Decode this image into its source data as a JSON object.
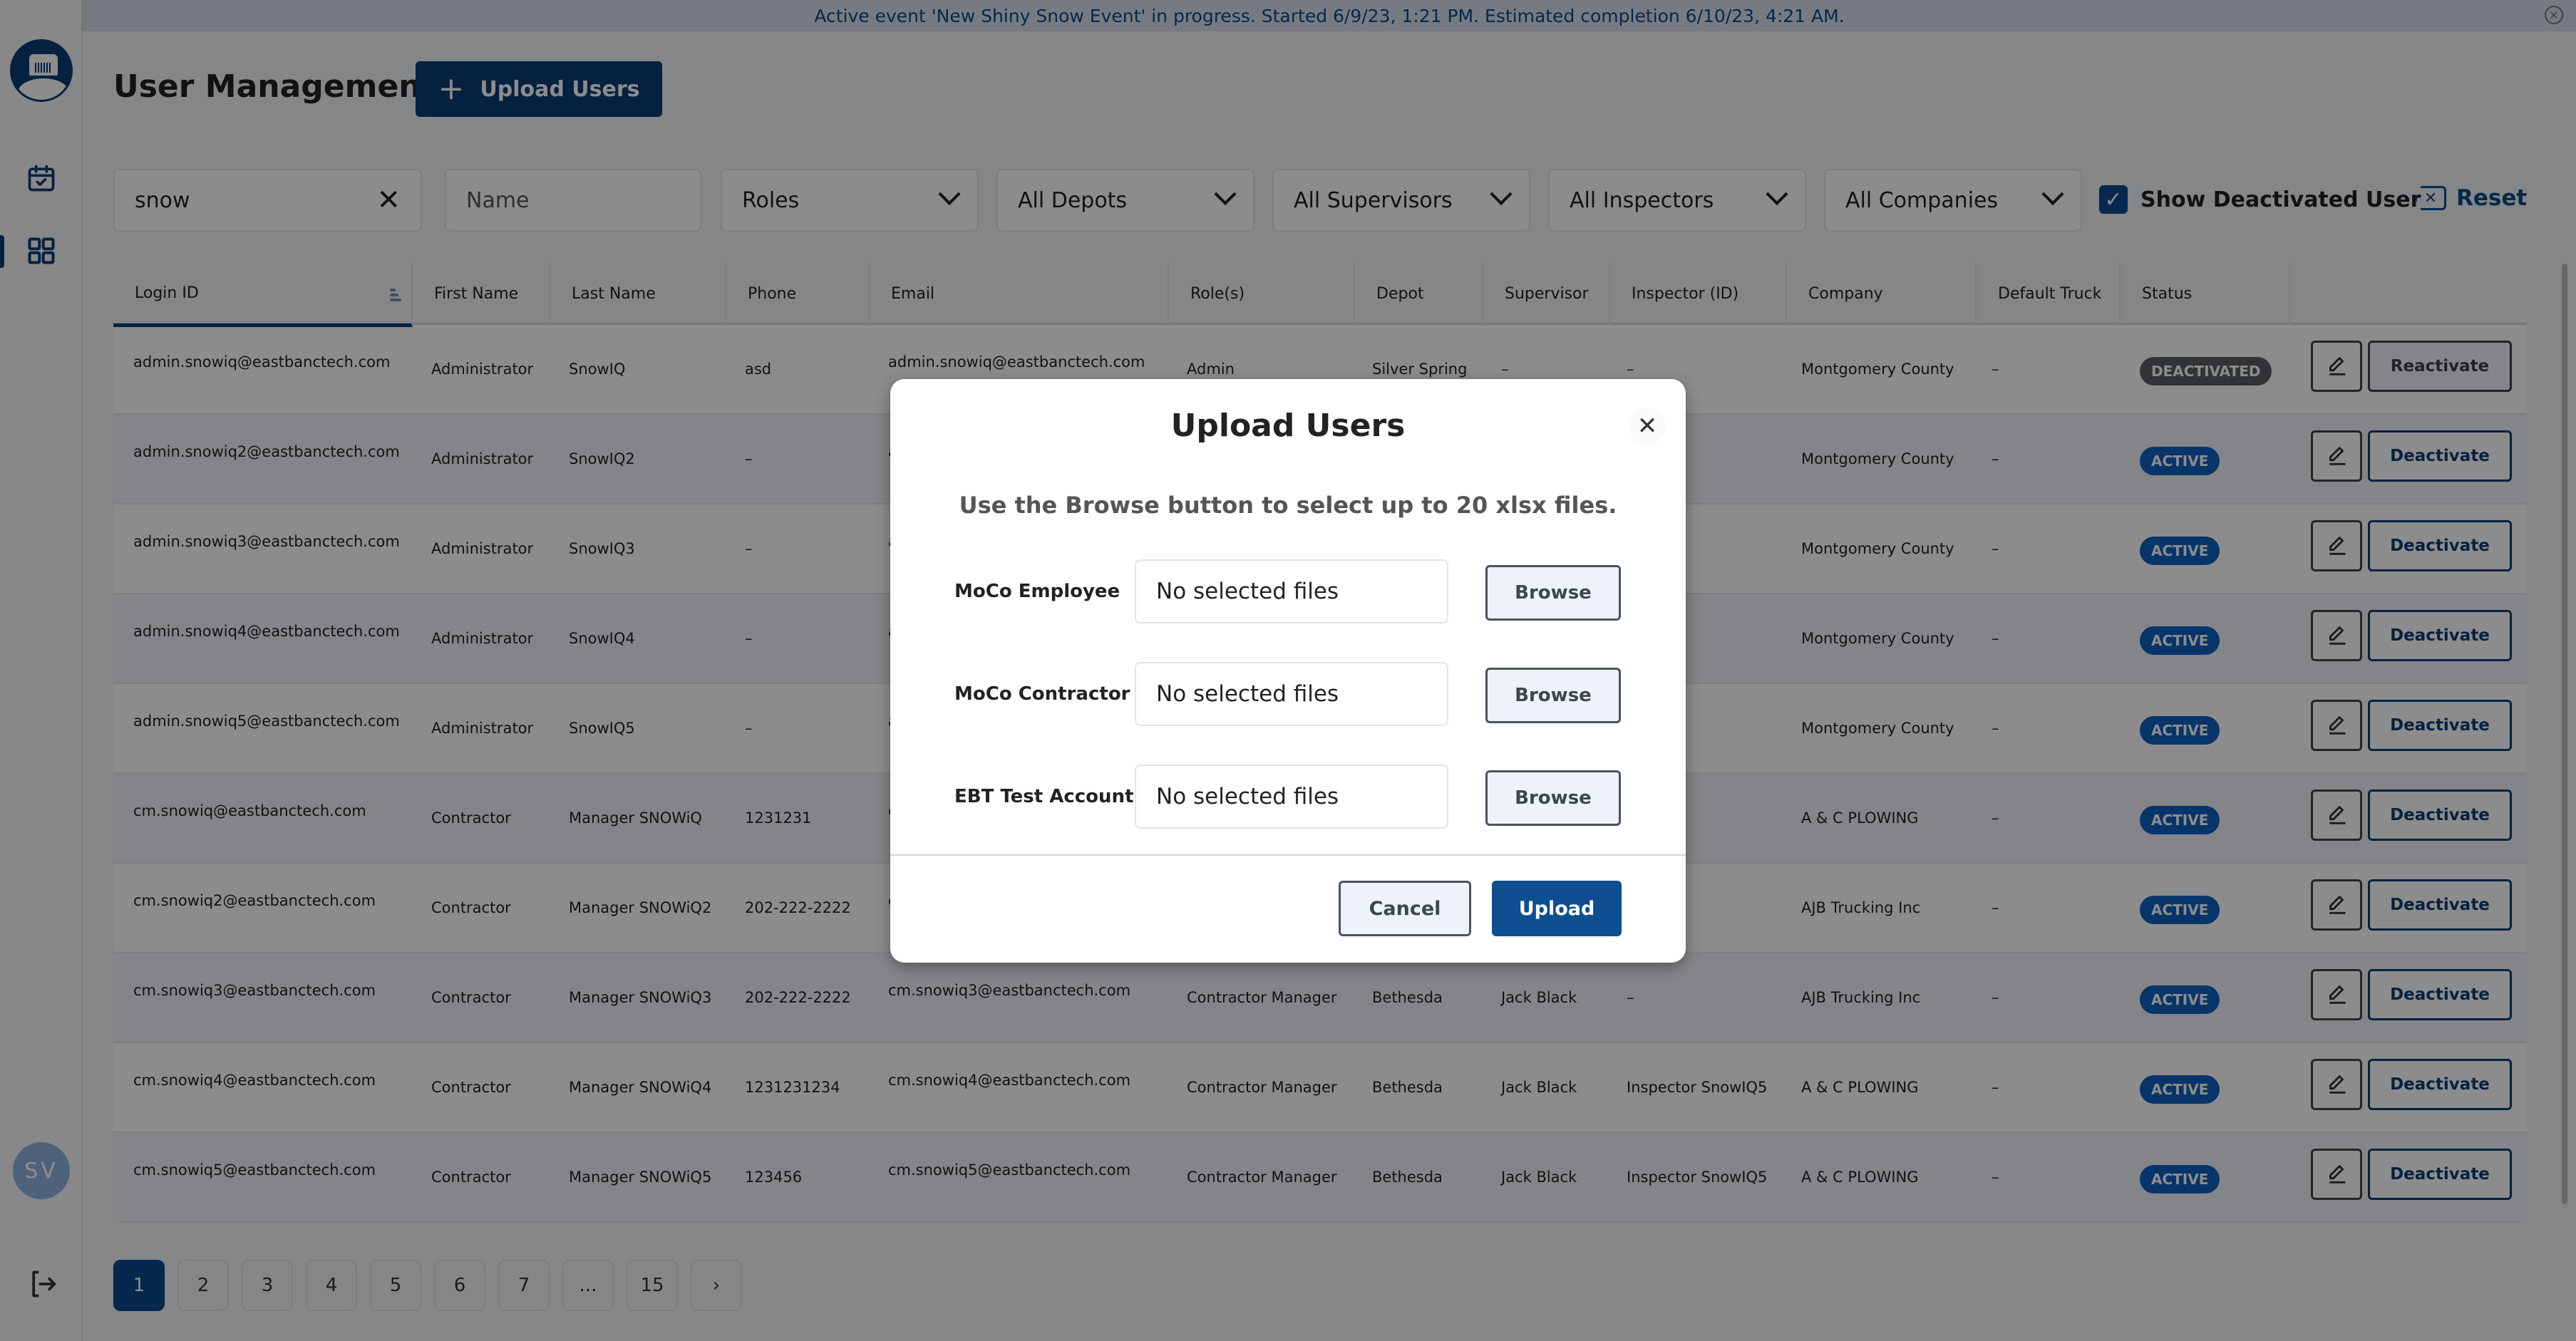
{
  "banner": {
    "text": "Active event 'New Shiny Snow Event' in progress. Started 6/9/23, 1:21 PM. Estimated completion 6/10/23, 4:21 AM.",
    "close_icon": "close-circle-icon"
  },
  "sidebar": {
    "logo_icon": "snow-truck-logo-icon",
    "items": [
      {
        "name": "events",
        "icon": "calendar-check-icon",
        "active": false
      },
      {
        "name": "user-management",
        "icon": "grid-icon",
        "active": true
      }
    ],
    "avatar_initials": "SV",
    "logout_icon": "logout-icon"
  },
  "header": {
    "title": "User Management",
    "upload_button": {
      "icon": "+",
      "label": "Upload Users"
    }
  },
  "filters": {
    "search_value": "snow",
    "name_placeholder": "Name",
    "roles": "Roles",
    "depots": "All Depots",
    "supervisors": "All Supervisors",
    "inspectors": "All Inspectors",
    "companies": "All Companies",
    "show_deactivated_label": "Show Deactivated User",
    "show_deactivated_checked": true,
    "checkmark": "✓",
    "reset_label": "Reset",
    "reset_icon": "✕",
    "clear_icon": "✕"
  },
  "table": {
    "columns": [
      "Login ID",
      "First Name",
      "Last Name",
      "Phone",
      "Email",
      "Role(s)",
      "Depot",
      "Supervisor",
      "Inspector (ID)",
      "Company",
      "Default Truck",
      "Status"
    ],
    "sorted_column": "Login ID",
    "rows": [
      {
        "login": "admin.snowiq@eastbanctech.com",
        "first": "Administrator",
        "last": "SnowIQ",
        "phone": "asd",
        "email": "admin.snowiq@eastbanctech.com",
        "role": "Admin",
        "depot": "Silver Spring",
        "supervisor": "–",
        "inspector": "–",
        "company": "Montgomery County",
        "truck": "–",
        "status": "DEACTIVATED",
        "action": "Reactivate"
      },
      {
        "login": "admin.snowiq2@eastbanctech.com",
        "first": "Administrator",
        "last": "SnowIQ2",
        "phone": "–",
        "email": "a",
        "role": "",
        "depot": "",
        "supervisor": "",
        "inspector": "",
        "company": "Montgomery County",
        "truck": "–",
        "status": "ACTIVE",
        "action": "Deactivate"
      },
      {
        "login": "admin.snowiq3@eastbanctech.com",
        "first": "Administrator",
        "last": "SnowIQ3",
        "phone": "–",
        "email": "a",
        "role": "",
        "depot": "",
        "supervisor": "",
        "inspector": "",
        "company": "Montgomery County",
        "truck": "–",
        "status": "ACTIVE",
        "action": "Deactivate"
      },
      {
        "login": "admin.snowiq4@eastbanctech.com",
        "first": "Administrator",
        "last": "SnowIQ4",
        "phone": "–",
        "email": "a",
        "role": "",
        "depot": "",
        "supervisor": "",
        "inspector": "",
        "company": "Montgomery County",
        "truck": "–",
        "status": "ACTIVE",
        "action": "Deactivate"
      },
      {
        "login": "admin.snowiq5@eastbanctech.com",
        "first": "Administrator",
        "last": "SnowIQ5",
        "phone": "–",
        "email": "a",
        "role": "",
        "depot": "",
        "supervisor": "",
        "inspector": "",
        "company": "Montgomery County",
        "truck": "–",
        "status": "ACTIVE",
        "action": "Deactivate"
      },
      {
        "login": "cm.snowiq@eastbanctech.com",
        "first": "Contractor",
        "last": "Manager SNOWiQ",
        "phone": "1231231",
        "email": "c",
        "role": "",
        "depot": "",
        "supervisor": "",
        "inspector": "",
        "company": "A & C PLOWING",
        "truck": "–",
        "status": "ACTIVE",
        "action": "Deactivate"
      },
      {
        "login": "cm.snowiq2@eastbanctech.com",
        "first": "Contractor",
        "last": "Manager SNOWiQ2",
        "phone": "202-222-2222",
        "email": "c",
        "role": "",
        "depot": "",
        "supervisor": "",
        "inspector": "",
        "company": "AJB Trucking Inc",
        "truck": "–",
        "status": "ACTIVE",
        "action": "Deactivate"
      },
      {
        "login": "cm.snowiq3@eastbanctech.com",
        "first": "Contractor",
        "last": "Manager SNOWiQ3",
        "phone": "202-222-2222",
        "email": "cm.snowiq3@eastbanctech.com",
        "role": "Contractor Manager",
        "depot": "Bethesda",
        "supervisor": "Jack Black",
        "inspector": "–",
        "company": "AJB Trucking Inc",
        "truck": "–",
        "status": "ACTIVE",
        "action": "Deactivate"
      },
      {
        "login": "cm.snowiq4@eastbanctech.com",
        "first": "Contractor",
        "last": "Manager SNOWiQ4",
        "phone": "1231231234",
        "email": "cm.snowiq4@eastbanctech.com",
        "role": "Contractor Manager",
        "depot": "Bethesda",
        "supervisor": "Jack Black",
        "inspector": "Inspector SnowIQ5",
        "company": "A & C PLOWING",
        "truck": "–",
        "status": "ACTIVE",
        "action": "Deactivate"
      },
      {
        "login": "cm.snowiq5@eastbanctech.com",
        "first": "Contractor",
        "last": "Manager SNOWiQ5",
        "phone": "123456",
        "email": "cm.snowiq5@eastbanctech.com",
        "role": "Contractor Manager",
        "depot": "Bethesda",
        "supervisor": "Jack Black",
        "inspector": "Inspector SnowIQ5",
        "company": "A & C PLOWING",
        "truck": "–",
        "status": "ACTIVE",
        "action": "Deactivate"
      }
    ]
  },
  "pagination": {
    "pages": [
      "1",
      "2",
      "3",
      "4",
      "5",
      "6",
      "7",
      "...",
      "15"
    ],
    "current": "1",
    "next_icon": "›"
  },
  "modal": {
    "title": "Upload Users",
    "close_icon": "✕",
    "subtitle": "Use the Browse button to select up to 20 xlsx files.",
    "file_rows": [
      {
        "label": "MoCo Employee",
        "value": "No selected files",
        "button": "Browse"
      },
      {
        "label": "MoCo Contractor",
        "value": "No selected files",
        "button": "Browse"
      },
      {
        "label": "EBT Test Account",
        "value": "No selected files",
        "button": "Browse"
      }
    ],
    "cancel_label": "Cancel",
    "upload_label": "Upload"
  },
  "colors": {
    "brand": "#0a3c75",
    "active_badge": "#0d62c2",
    "deactivated_badge": "#5a5f63",
    "banner_text": "#0b4a8b"
  }
}
